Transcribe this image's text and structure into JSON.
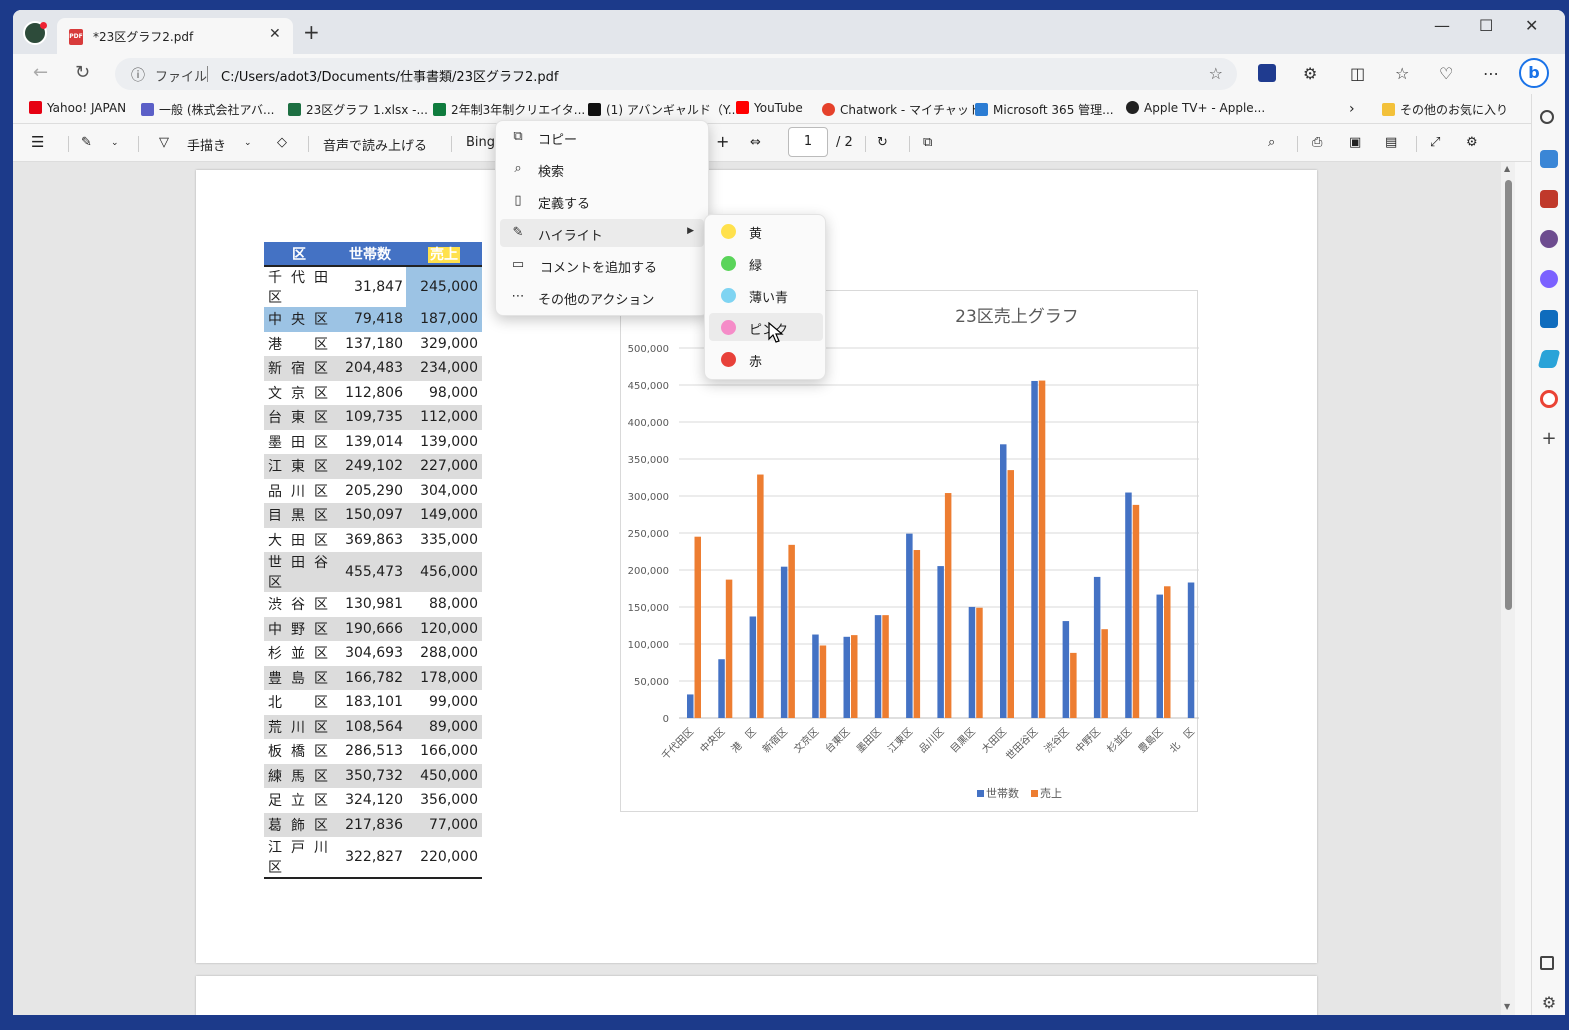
{
  "tab": {
    "title": "*23区グラフ2.pdf",
    "pdf_badge": "PDF"
  },
  "address": {
    "label": "ファイル",
    "url": "C:/Users/adot3/Documents/仕事書類/23区グラフ2.pdf"
  },
  "favorites": [
    {
      "label": "Yahoo! JAPAN",
      "color": "#e60012"
    },
    {
      "label": "一般 (株式会社アバ...",
      "color": "#5b5fc7"
    },
    {
      "label": "23区グラフ 1.xlsx -...",
      "color": "#1d6f42"
    },
    {
      "label": "2年制3年制クリエイタ...",
      "color": "#0f7b3d"
    },
    {
      "label": "(1) アバンギャルド（Y...",
      "color": "#111111"
    },
    {
      "label": "YouTube",
      "color": "#ff0000"
    },
    {
      "label": "Chatwork - マイチャット",
      "color": "#e5412b"
    },
    {
      "label": "Microsoft 365 管理...",
      "color": "#2b7cd3"
    },
    {
      "label": "Apple TV+ - Apple...",
      "color": "#222222"
    }
  ],
  "favorites_other": "その他のお気に入り",
  "pdf_toolbar": {
    "draw": "手描き",
    "read_aloud": "音声で読み上げる",
    "bing": "Bing",
    "page_current": "1",
    "page_total": "/ 2"
  },
  "table": {
    "headers": [
      "区",
      "世帯数",
      "売上"
    ],
    "rows": [
      [
        "千代田区",
        "31,847",
        "245,000"
      ],
      [
        "中央区",
        "79,418",
        "187,000"
      ],
      [
        "港区",
        "137,180",
        "329,000"
      ],
      [
        "新宿区",
        "204,483",
        "234,000"
      ],
      [
        "文京区",
        "112,806",
        "98,000"
      ],
      [
        "台東区",
        "109,735",
        "112,000"
      ],
      [
        "墨田区",
        "139,014",
        "139,000"
      ],
      [
        "江東区",
        "249,102",
        "227,000"
      ],
      [
        "品川区",
        "205,290",
        "304,000"
      ],
      [
        "目黒区",
        "150,097",
        "149,000"
      ],
      [
        "大田区",
        "369,863",
        "335,000"
      ],
      [
        "世田谷区",
        "455,473",
        "456,000"
      ],
      [
        "渋谷区",
        "130,981",
        "88,000"
      ],
      [
        "中野区",
        "190,666",
        "120,000"
      ],
      [
        "杉並区",
        "304,693",
        "288,000"
      ],
      [
        "豊島区",
        "166,782",
        "178,000"
      ],
      [
        "北区",
        "183,101",
        "99,000"
      ],
      [
        "荒川区",
        "108,564",
        "89,000"
      ],
      [
        "板橋区",
        "286,513",
        "166,000"
      ],
      [
        "練馬区",
        "350,732",
        "450,000"
      ],
      [
        "足立区",
        "324,120",
        "356,000"
      ],
      [
        "葛飾区",
        "217,836",
        "77,000"
      ],
      [
        "江戸川区",
        "322,827",
        "220,000"
      ]
    ]
  },
  "chart_data": {
    "type": "bar",
    "title": "23区売上グラフ",
    "categories": [
      "千代田区",
      "中央区",
      "港　区",
      "新宿区",
      "文京区",
      "台東区",
      "墨田区",
      "江東区",
      "品川区",
      "目黒区",
      "大田区",
      "世田谷区",
      "渋谷区",
      "中野区",
      "杉並区",
      "豊島区",
      "北　区"
    ],
    "series": [
      {
        "name": "世帯数",
        "color": "#4472c4",
        "values": [
          31847,
          79418,
          137180,
          204483,
          112806,
          109735,
          139014,
          249102,
          205290,
          150097,
          369863,
          455473,
          130981,
          190666,
          304693,
          166782,
          183101
        ]
      },
      {
        "name": "売上",
        "color": "#ed7d31",
        "values": [
          245000,
          187000,
          329000,
          234000,
          98000,
          112000,
          139000,
          227000,
          304000,
          149000,
          335000,
          456000,
          88000,
          120000,
          288000,
          178000,
          null
        ]
      }
    ],
    "y_ticks": [
      "0",
      "50,000",
      "100,000",
      "150,000",
      "200,000",
      "250,000",
      "300,000",
      "350,000",
      "400,000",
      "450,000",
      "500,000"
    ],
    "ylim": [
      0,
      500000
    ],
    "grid": true,
    "legend_position": "bottom"
  },
  "context_menu": {
    "items": [
      {
        "label": "コピー",
        "icon": "copy-icon"
      },
      {
        "label": "検索",
        "icon": "search-icon"
      },
      {
        "label": "定義する",
        "icon": "book-icon"
      },
      {
        "label": "ハイライト",
        "icon": "highlighter-icon"
      },
      {
        "label": "コメントを追加する",
        "icon": "comment-icon"
      },
      {
        "label": "その他のアクション",
        "icon": "more-icon"
      }
    ],
    "active_item": "ハイライト"
  },
  "highlight_submenu": {
    "items": [
      {
        "label": "黄",
        "color": "#ffe14d"
      },
      {
        "label": "緑",
        "color": "#5ad45a"
      },
      {
        "label": "薄い青",
        "color": "#7fd4f2"
      },
      {
        "label": "ピンク",
        "color": "#f58cc8"
      },
      {
        "label": "赤",
        "color": "#e8413a"
      }
    ],
    "hovered": "ピンク"
  }
}
